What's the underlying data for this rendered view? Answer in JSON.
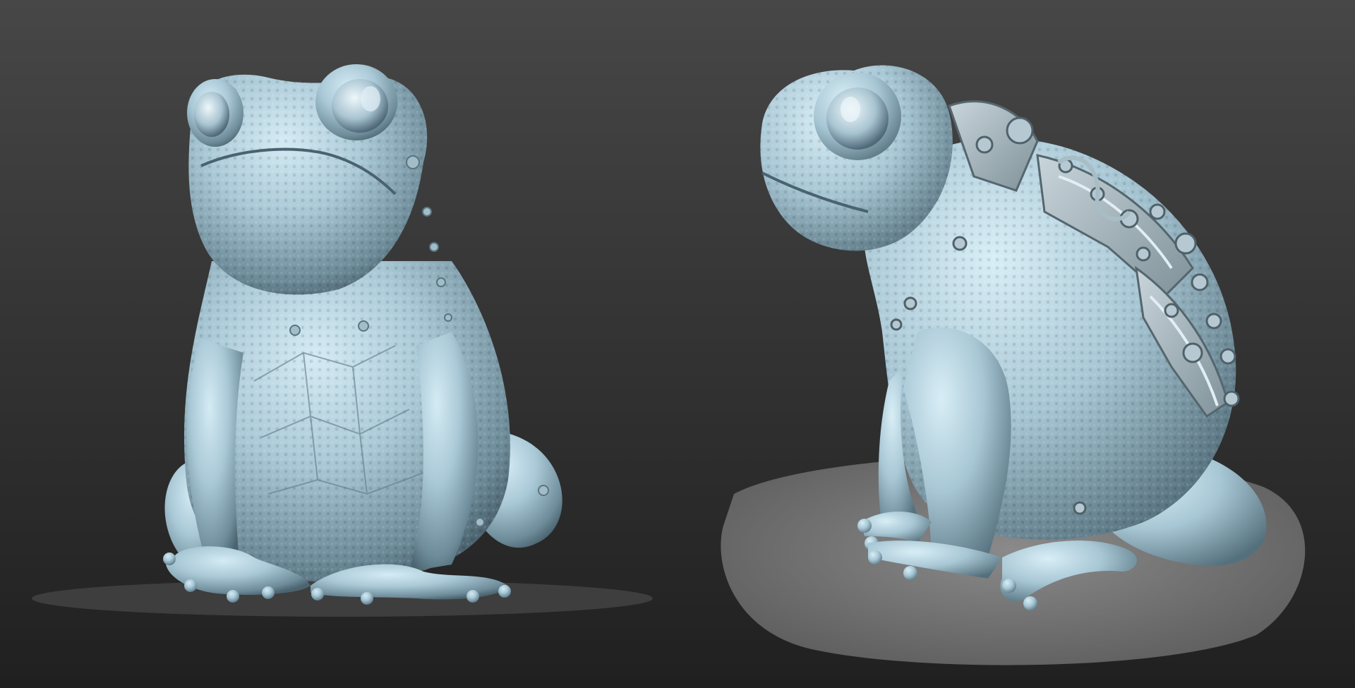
{
  "scene": {
    "background_top": "#474747",
    "background_bottom": "#202020",
    "skin_light": "#c9e3ee",
    "skin_mid": "#9fc0cf",
    "skin_dark": "#5f7d8c",
    "plate_color": "#b7c6cd",
    "ground_color": "#6e6e6e",
    "shadow_color": "#3c3c3c"
  },
  "views": [
    {
      "name": "front-view",
      "subject": "frog-sculpt",
      "orientation": "front"
    },
    {
      "name": "three-quarter-view",
      "subject": "frog-sculpt-with-mechanical-plates",
      "orientation": "three-quarter-left"
    }
  ]
}
